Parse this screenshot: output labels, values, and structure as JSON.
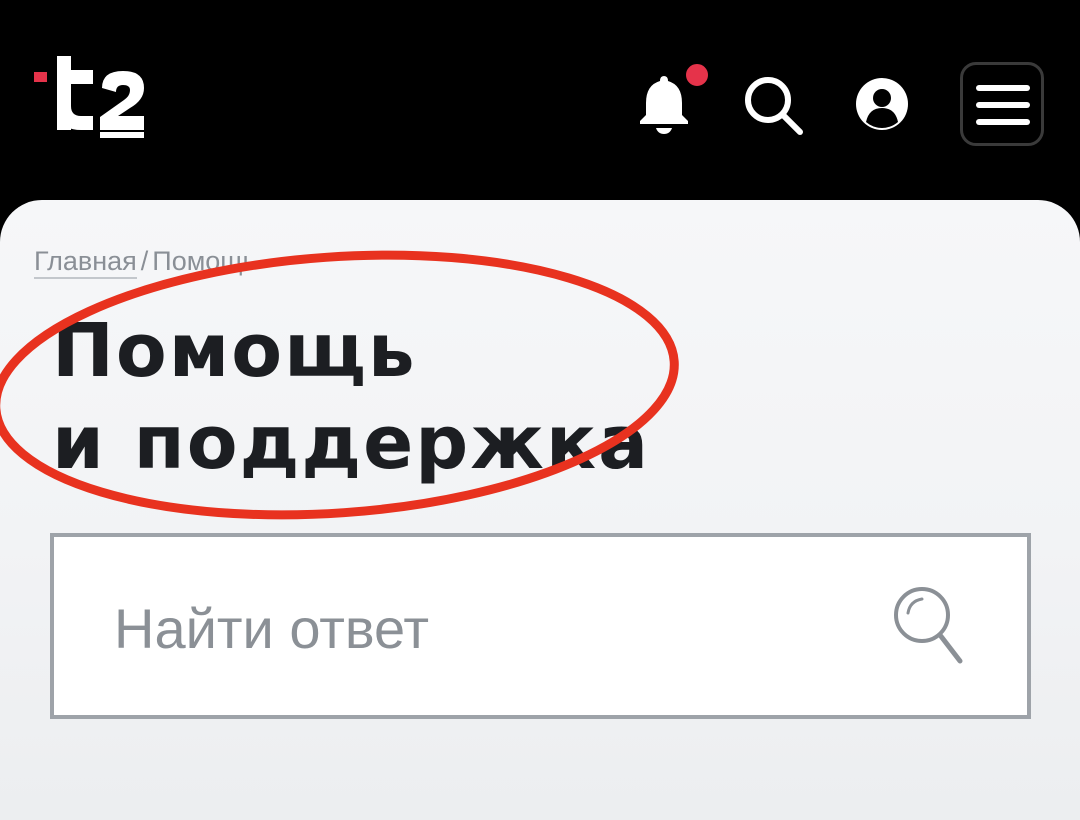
{
  "header": {
    "logo_icon": "t2-logo",
    "has_notification": true,
    "colors": {
      "background": "#000000",
      "accent": "#e5334a",
      "icon": "#ffffff"
    },
    "icons": [
      "bell-icon",
      "search-icon",
      "profile-icon",
      "menu-icon"
    ]
  },
  "breadcrumb": {
    "home": "Главная",
    "separator": "/",
    "current": "Помощь"
  },
  "title": {
    "line1": "Помощь",
    "line2": "и поддержка"
  },
  "search": {
    "placeholder": "Найти ответ",
    "value": "",
    "icon": "search-icon"
  },
  "annotation": {
    "shape": "ellipse",
    "color": "#e8321f"
  }
}
